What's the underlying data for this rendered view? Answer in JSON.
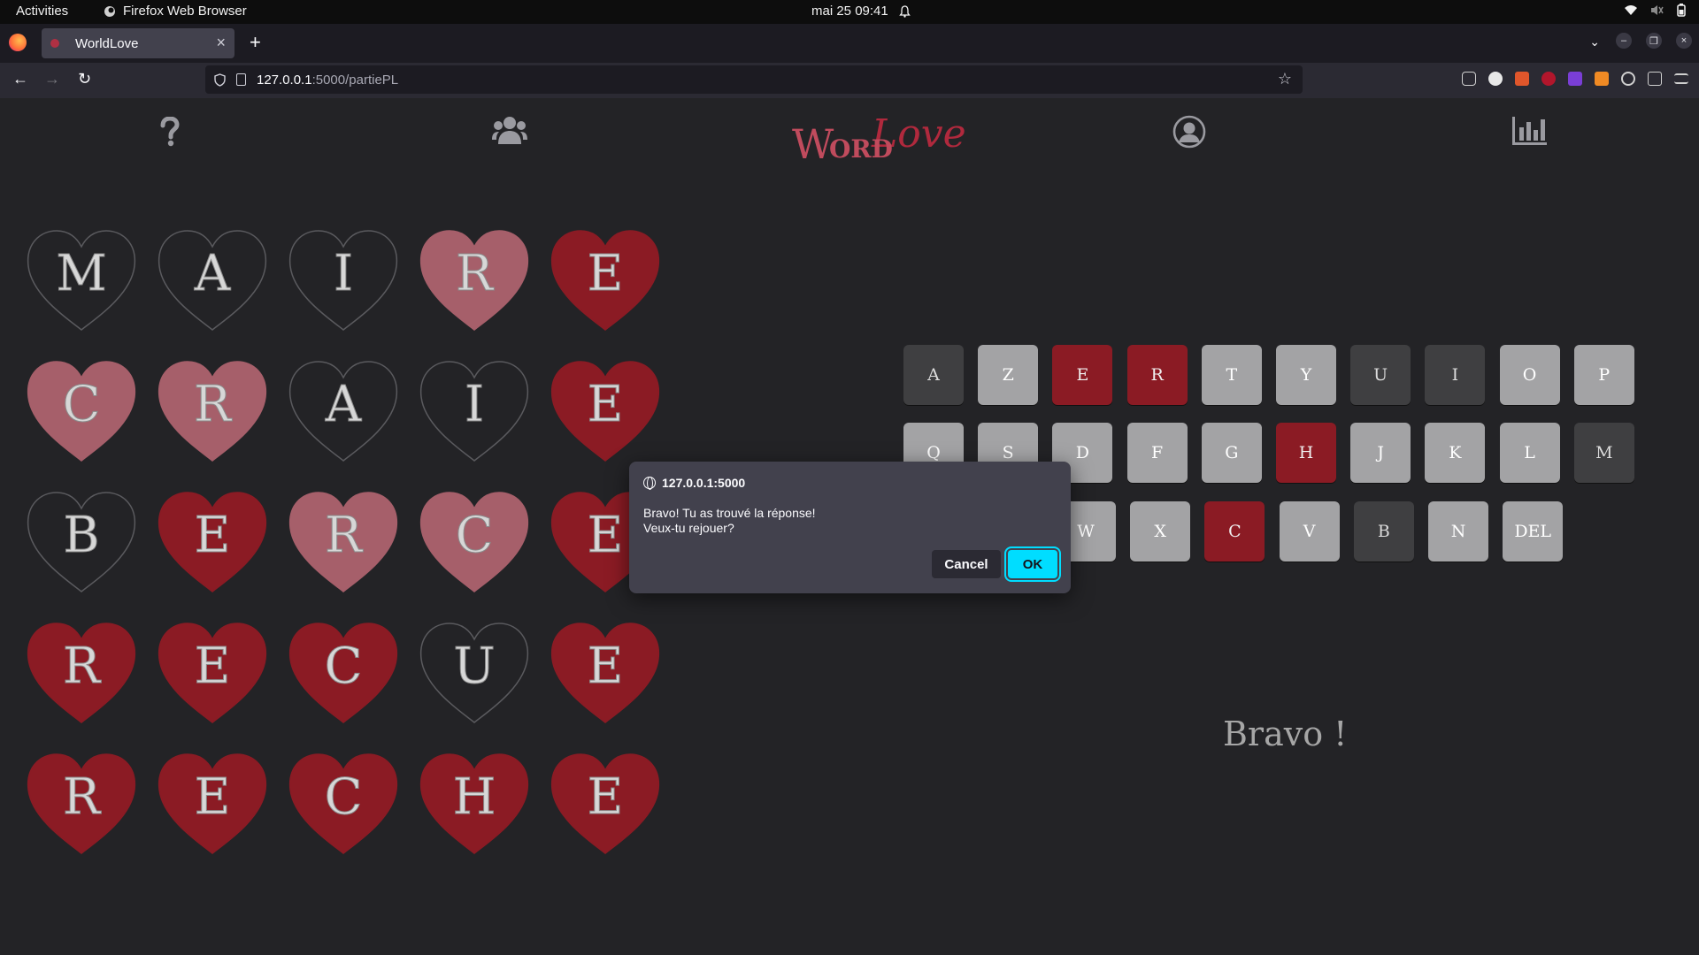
{
  "system_bar": {
    "activities": "Activities",
    "app": "Firefox Web Browser",
    "clock": "mai 25  09:41"
  },
  "browser": {
    "tab_title": "WorldLove",
    "url_host": "127.0.0.1",
    "url_path": ":5000/partiePL"
  },
  "header": {
    "logo_w": "W",
    "logo_ord": "ORD",
    "logo_love": "Love"
  },
  "grid": {
    "rows": [
      [
        {
          "l": "M",
          "s": "absent"
        },
        {
          "l": "A",
          "s": "absent"
        },
        {
          "l": "I",
          "s": "absent"
        },
        {
          "l": "R",
          "s": "present"
        },
        {
          "l": "E",
          "s": "correct"
        }
      ],
      [
        {
          "l": "C",
          "s": "present"
        },
        {
          "l": "R",
          "s": "present"
        },
        {
          "l": "A",
          "s": "absent"
        },
        {
          "l": "I",
          "s": "absent"
        },
        {
          "l": "E",
          "s": "correct"
        }
      ],
      [
        {
          "l": "B",
          "s": "absent"
        },
        {
          "l": "E",
          "s": "correct"
        },
        {
          "l": "R",
          "s": "present"
        },
        {
          "l": "C",
          "s": "present"
        },
        {
          "l": "E",
          "s": "correct"
        }
      ],
      [
        {
          "l": "R",
          "s": "correct"
        },
        {
          "l": "E",
          "s": "correct"
        },
        {
          "l": "C",
          "s": "correct"
        },
        {
          "l": "U",
          "s": "absent"
        },
        {
          "l": "E",
          "s": "correct"
        }
      ],
      [
        {
          "l": "R",
          "s": "correct"
        },
        {
          "l": "E",
          "s": "correct"
        },
        {
          "l": "C",
          "s": "correct"
        },
        {
          "l": "H",
          "s": "correct"
        },
        {
          "l": "E",
          "s": "correct"
        }
      ]
    ]
  },
  "keyboard": {
    "row1": [
      {
        "k": "A",
        "s": "absent"
      },
      {
        "k": "Z",
        "s": "unused"
      },
      {
        "k": "E",
        "s": "found"
      },
      {
        "k": "R",
        "s": "found"
      },
      {
        "k": "T",
        "s": "unused"
      },
      {
        "k": "Y",
        "s": "unused"
      },
      {
        "k": "U",
        "s": "absent"
      },
      {
        "k": "I",
        "s": "absent"
      },
      {
        "k": "O",
        "s": "unused"
      },
      {
        "k": "P",
        "s": "unused"
      }
    ],
    "row2": [
      {
        "k": "Q",
        "s": "unused"
      },
      {
        "k": "S",
        "s": "unused"
      },
      {
        "k": "D",
        "s": "unused"
      },
      {
        "k": "F",
        "s": "unused"
      },
      {
        "k": "G",
        "s": "unused"
      },
      {
        "k": "H",
        "s": "found"
      },
      {
        "k": "J",
        "s": "unused"
      },
      {
        "k": "K",
        "s": "unused"
      },
      {
        "k": "L",
        "s": "unused"
      },
      {
        "k": "M",
        "s": "absent"
      }
    ],
    "row3": [
      {
        "k": "W",
        "s": "unused"
      },
      {
        "k": "X",
        "s": "unused"
      },
      {
        "k": "C",
        "s": "found"
      },
      {
        "k": "V",
        "s": "unused"
      },
      {
        "k": "B",
        "s": "absent"
      },
      {
        "k": "N",
        "s": "unused"
      },
      {
        "k": "DEL",
        "s": "unused"
      }
    ]
  },
  "result_text": "Bravo !",
  "dialog": {
    "origin": "127.0.0.1:5000",
    "line1": "Bravo! Tu as trouvé la réponse!",
    "line2": "Veux-tu rejouer?",
    "cancel": "Cancel",
    "ok": "OK"
  },
  "colors": {
    "correct": "#8b1b24",
    "present": "#a65f6a",
    "absent_outline": "#5a5a5e",
    "accent": "#00ddff"
  }
}
